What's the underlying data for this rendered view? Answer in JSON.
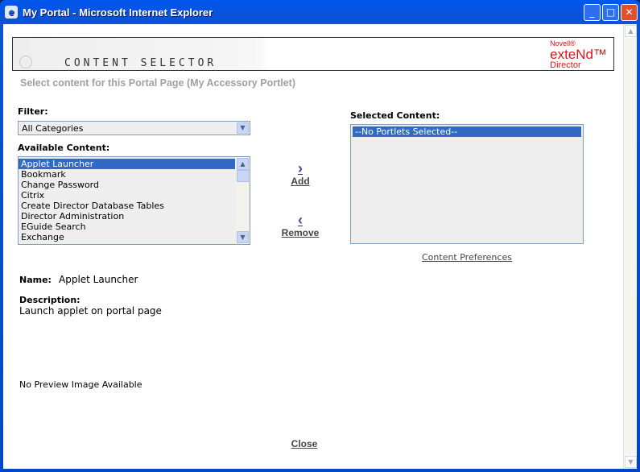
{
  "window": {
    "title": "My Portal - Microsoft Internet Explorer"
  },
  "banner": {
    "title": "CONTENT SELECTOR",
    "logo_brand": "Novell®",
    "logo_product": "exteNd™",
    "logo_sub": "Director"
  },
  "subtitle": "Select content for this Portal Page (My Accessory Portlet)",
  "filter": {
    "label": "Filter:",
    "value": "All Categories"
  },
  "available": {
    "label": "Available Content:",
    "items": [
      "Applet Launcher",
      "Bookmark",
      "Change Password",
      "Citrix",
      "Create Director Database Tables",
      "Director Administration",
      "EGuide Search",
      "Exchange"
    ],
    "selected_index": 0
  },
  "actions": {
    "add": "Add",
    "remove": "Remove"
  },
  "selected": {
    "label": "Selected Content:",
    "items": [
      "--No Portlets Selected--"
    ]
  },
  "content_preferences": "Content Preferences",
  "details": {
    "name_label": "Name:",
    "name_value": "Applet Launcher",
    "description_label": "Description:",
    "description_value": "Launch applet on portal page",
    "preview": "No Preview Image Available"
  },
  "close": "Close"
}
